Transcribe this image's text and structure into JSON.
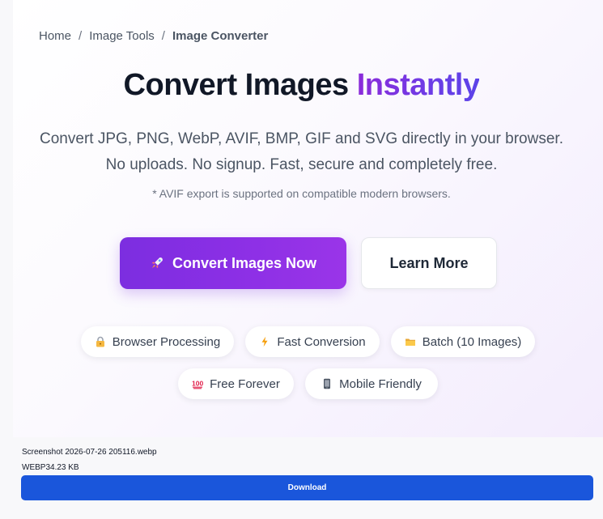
{
  "breadcrumb": {
    "home": "Home",
    "separator": "/",
    "tools": "Image Tools",
    "current": "Image Converter"
  },
  "hero": {
    "title_main": "Convert Images",
    "title_accent": "Instantly",
    "subtitle_line1": "Convert JPG, PNG, WebP, AVIF, BMP, GIF and SVG directly in your browser.",
    "subtitle_line2": "No uploads. No signup. Fast, secure and completely free.",
    "note": "* AVIF export is supported on compatible modern browsers.",
    "primary_button": "Convert Images Now",
    "secondary_button": "Learn More"
  },
  "features": [
    {
      "label": "Browser Processing",
      "icon": "lock-icon"
    },
    {
      "label": "Fast Conversion",
      "icon": "lightning-icon"
    },
    {
      "label": "Batch (10 Images)",
      "icon": "folder-icon"
    },
    {
      "label": "Free Forever",
      "icon": "hundred-points-icon"
    },
    {
      "label": "Mobile Friendly",
      "icon": "mobile-phone-icon"
    }
  ],
  "file": {
    "name": "Screenshot 2026-07-26 205116.webp",
    "format": "WEBP",
    "size": "34.23 KB",
    "download_label": "Download"
  },
  "colors": {
    "accent_purple": "#8b2fe5",
    "download_blue": "#1a56db",
    "title_dark": "#111827"
  }
}
